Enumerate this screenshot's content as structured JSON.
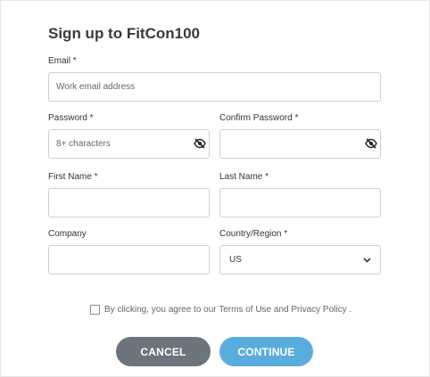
{
  "form": {
    "title": "Sign up to FitCon100",
    "email": {
      "label": "Email *",
      "placeholder": "Work email address",
      "value": ""
    },
    "password": {
      "label": "Password *",
      "placeholder": "8+ characters",
      "value": ""
    },
    "confirm_password": {
      "label": "Confirm Password *",
      "placeholder": "",
      "value": ""
    },
    "first_name": {
      "label": "First Name *",
      "value": ""
    },
    "last_name": {
      "label": "Last Name *",
      "value": ""
    },
    "company": {
      "label": "Company",
      "value": ""
    },
    "country": {
      "label": "Country/Region *",
      "selected": "US"
    },
    "agreement": {
      "text": "By clicking, you agree to our Terms of Use and Privacy Policy .",
      "checked": false
    },
    "cancel_label": "CANCEL",
    "continue_label": "CONTINUE"
  },
  "icons": {
    "password_toggle": "eye-off-icon",
    "confirm_password_toggle": "eye-off-icon",
    "country_dropdown": "chevron-down-icon"
  },
  "colors": {
    "cancel_button": "#6c757d",
    "continue_button": "#5aacde",
    "input_border": "#cfcfcf"
  }
}
